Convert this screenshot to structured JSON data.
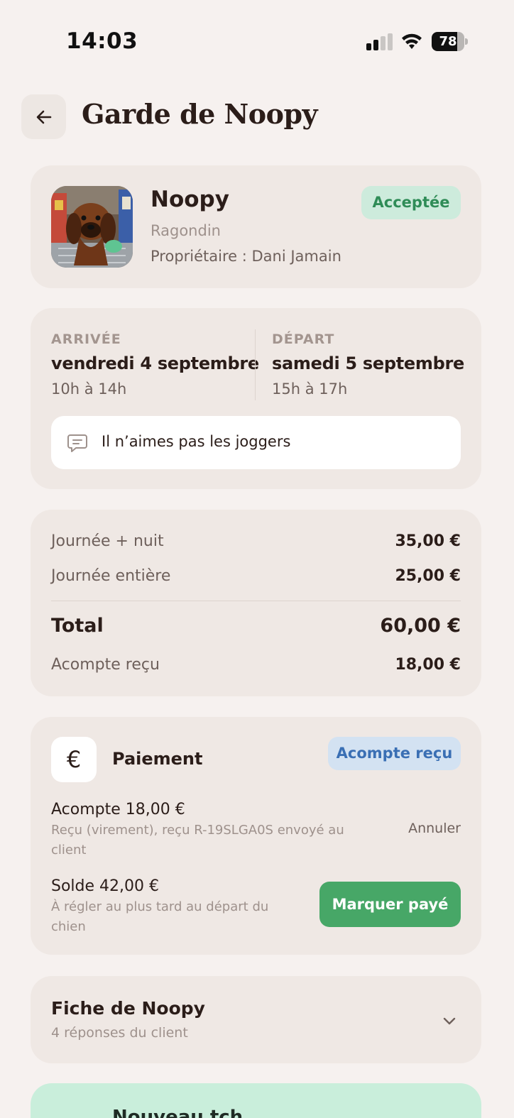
{
  "status_bar": {
    "time": "14:03",
    "battery": "78",
    "battery_level": 0.78,
    "icons": [
      "cellular-signal-icon",
      "wifi-icon",
      "battery-icon"
    ]
  },
  "header": {
    "title": "Garde de Noopy",
    "back_icon": "arrow-left-icon"
  },
  "pet": {
    "name": "Noopy",
    "breed": "Ragondin",
    "owner": "Propriétaire : Dani Jamain",
    "status": "Acceptée",
    "status_color": "#2f8c57"
  },
  "stay": {
    "arrival": {
      "label": "ARRIVÉE",
      "day": "vendredi 4 septembre",
      "hours": "10h à 14h"
    },
    "departure": {
      "label": "DÉPART",
      "day": "samedi 5 septembre",
      "hours": "15h à 17h"
    },
    "note": "Il n’aimes pas les joggers",
    "note_icon": "chat-bubble-icon"
  },
  "pricing": {
    "lines": [
      {
        "label": "Journée + nuit",
        "value": "35,00 €"
      },
      {
        "label": "Journée entière",
        "value": "25,00 €"
      }
    ],
    "total_label": "Total",
    "total_value": "60,00 €",
    "deposit_label": "Acompte reçu",
    "deposit_value": "18,00 €"
  },
  "payment": {
    "icon_symbol": "€",
    "title": "Paiement",
    "badge": "Acompte reçu",
    "deposit_title": "Acompte 18,00 €",
    "deposit_sub": "Reçu (virement), reçu R-19SLGA0S envoyé au client",
    "cancel_label": "Annuler",
    "balance_title": "Solde 42,00 €",
    "balance_sub": "À régler au plus tard au départ du chien",
    "mark_paid_label": "Marquer payé",
    "accent": "#47a767"
  },
  "fiche": {
    "title": "Fiche de Noopy",
    "subtitle": "4 réponses du client",
    "chevron_icon": "chevron-down-icon"
  },
  "bottom_card": {
    "title": "Nouveau tch..."
  }
}
